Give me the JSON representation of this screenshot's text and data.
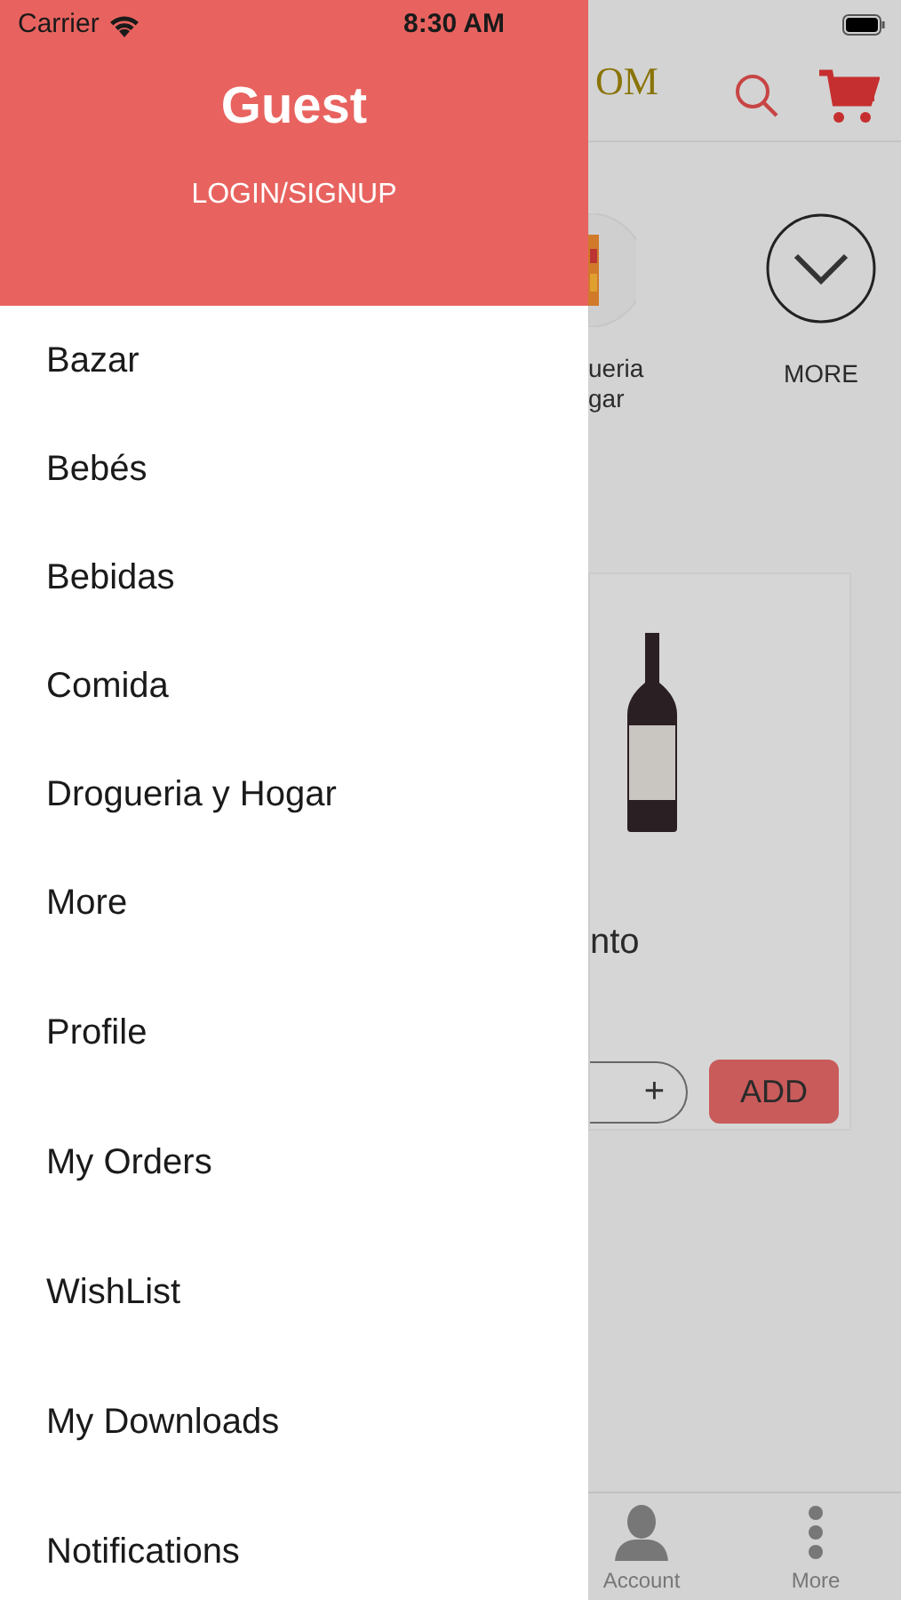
{
  "status_bar": {
    "carrier": "Carrier",
    "time": "8:30 AM"
  },
  "drawer": {
    "user_name": "Guest",
    "login_label": "LOGIN/SIGNUP",
    "groups": [
      {
        "items": [
          {
            "label": "Bazar"
          },
          {
            "label": "Bebés"
          },
          {
            "label": "Bebidas"
          },
          {
            "label": "Comida"
          },
          {
            "label": "Drogueria y Hogar"
          },
          {
            "label": "More"
          }
        ]
      },
      {
        "items": [
          {
            "label": "Profile"
          },
          {
            "label": "My Orders"
          },
          {
            "label": "WishList"
          },
          {
            "label": "My Downloads"
          },
          {
            "label": "Notifications"
          }
        ]
      }
    ]
  },
  "background": {
    "logo_text": "OM",
    "categories": [
      {
        "kind": "picture",
        "lines": [
          "ueria",
          "gar"
        ]
      },
      {
        "kind": "more",
        "lines": [
          "MORE"
        ]
      }
    ],
    "card": {
      "title": "nto",
      "plus": "+",
      "add_label": "ADD"
    },
    "tab_bar": [
      {
        "kind": "account",
        "label": "Account"
      },
      {
        "kind": "more",
        "label": "More"
      }
    ]
  }
}
